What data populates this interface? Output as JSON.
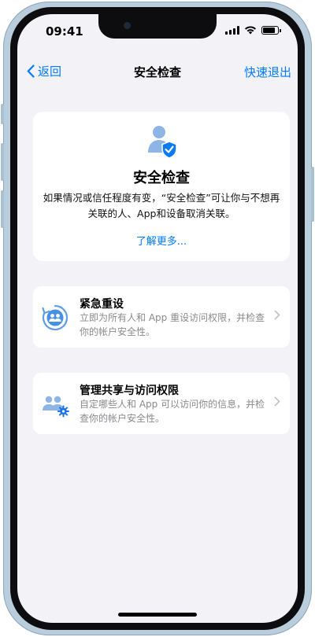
{
  "status": {
    "time": "09:41"
  },
  "nav": {
    "back_label": "返回",
    "title": "安全检查",
    "quick_exit_label": "快速退出"
  },
  "hero": {
    "title": "安全检查",
    "description": "如果情况或信任程度有变，“安全检查”可让你与不想再关联的人、App和设备取消关联。",
    "learn_more": "了解更多..."
  },
  "rows": [
    {
      "title": "紧急重设",
      "description": "立即为所有人和 App 重设访问权限，并检查你的帐户安全性。",
      "icon": "emergency-reset-icon"
    },
    {
      "title": "管理共享与访问权限",
      "description": "自定哪些人和 App 可以访问你的信息，并检查你的帐户安全性。",
      "icon": "manage-sharing-icon"
    }
  ],
  "colors": {
    "accent": "#007aff",
    "background": "#f2f2f7",
    "secondary_text": "#8a8a8e"
  }
}
